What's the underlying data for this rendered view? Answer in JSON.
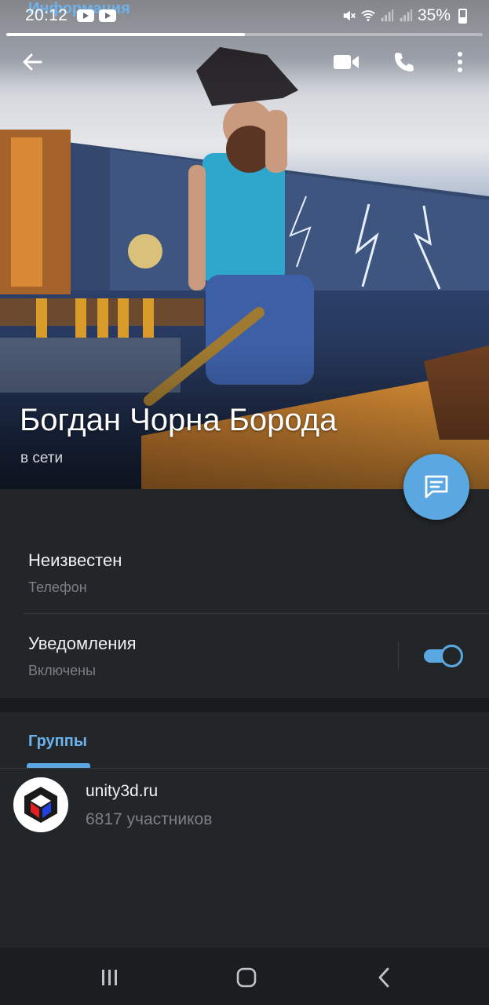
{
  "status_bar": {
    "time": "20:12",
    "battery": "35%",
    "icons": [
      "youtube-icon",
      "youtube-icon",
      "mute-icon",
      "wifi-icon",
      "signal-icon",
      "signal-icon",
      "battery-icon"
    ]
  },
  "story_progress": 0.5,
  "toolbar": {
    "icons": [
      "back-arrow-icon",
      "video-call-icon",
      "phone-icon",
      "more-vertical-icon"
    ]
  },
  "profile": {
    "name": "Богдан Чорна Борода",
    "status": "в сети",
    "fab_icon": "message-icon"
  },
  "info": {
    "section_title": "Информация",
    "phone_value": "Неизвестен",
    "phone_label": "Телефон",
    "notifications_title": "Уведомления",
    "notifications_state": "Включены",
    "notifications_enabled": true
  },
  "groups": {
    "tab_label": "Группы",
    "items": [
      {
        "name": "unity3d.ru",
        "members": "6817 участников",
        "avatar_icon": "unity-logo-icon"
      }
    ]
  },
  "navbar": {
    "icons": [
      "recents-icon",
      "home-icon",
      "back-icon"
    ]
  },
  "colors": {
    "accent": "#5ba7e2",
    "section_title": "#6cb2ec",
    "background": "#232629"
  }
}
